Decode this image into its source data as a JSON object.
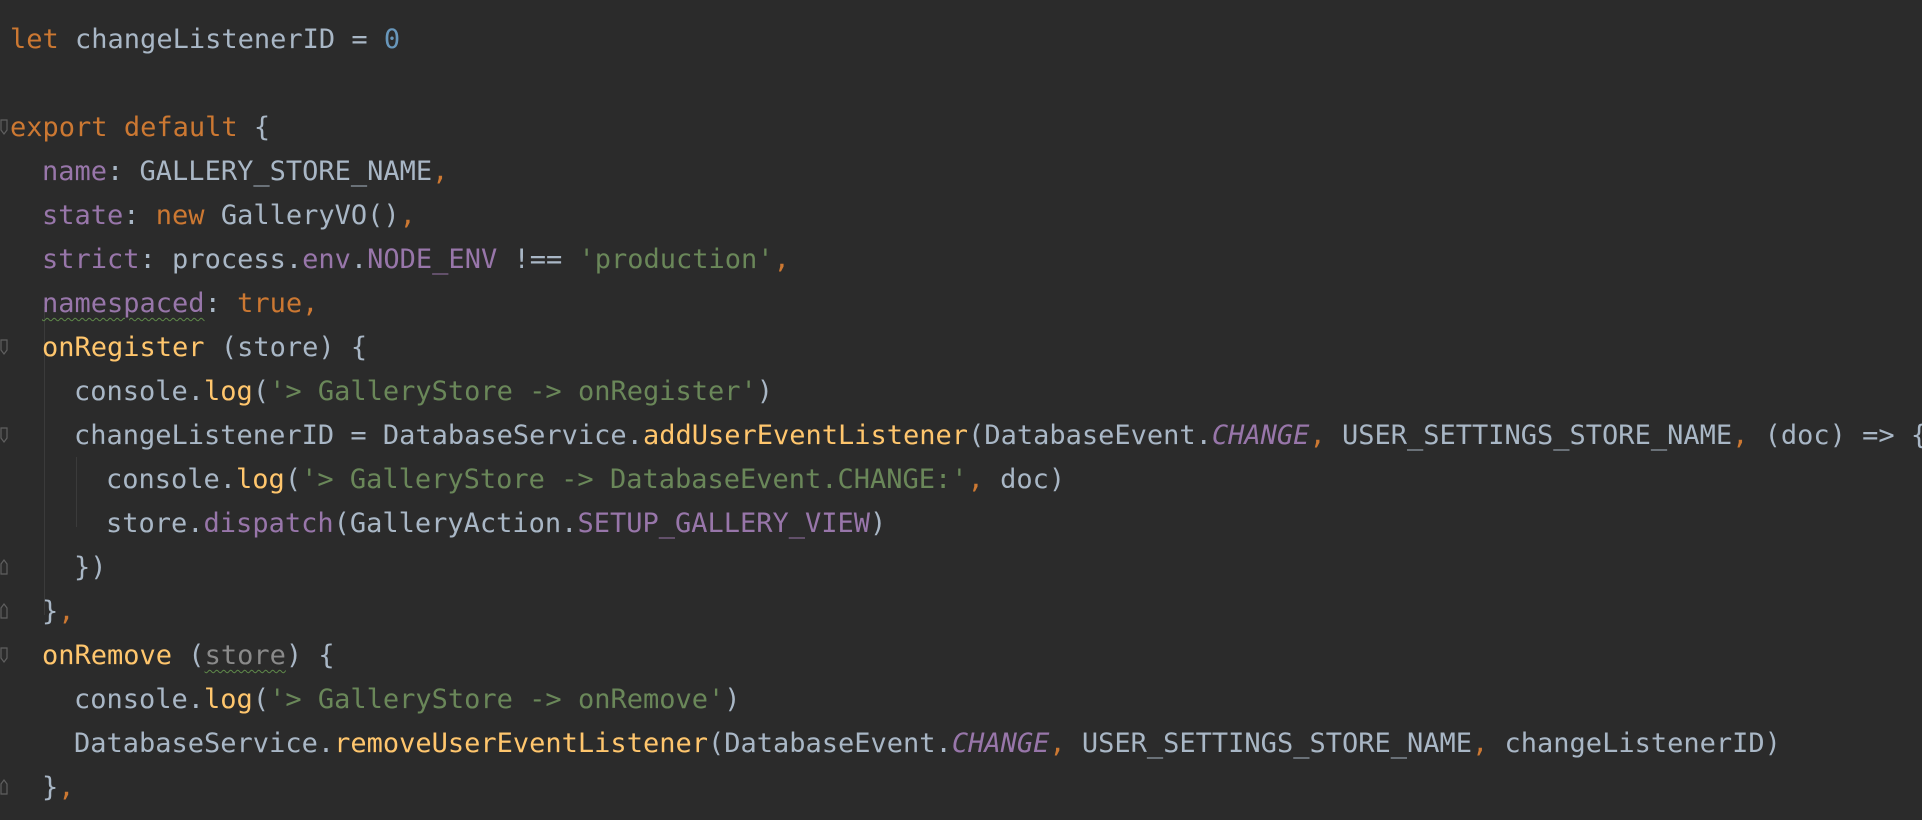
{
  "editor": {
    "language": "javascript",
    "colors": {
      "background": "#2b2b2b",
      "keyword": "#cc7832",
      "property": "#9876aa",
      "string": "#6a8759",
      "number": "#6897bb",
      "function": "#ffc66d",
      "text": "#a9b7c6"
    }
  },
  "code": {
    "l1": [
      "let",
      " changeListenerID = ",
      "0"
    ],
    "l3": [
      "export",
      " ",
      "default",
      " {"
    ],
    "l4": [
      "name",
      ": GALLERY_STORE_NAME",
      ","
    ],
    "l5": [
      "state",
      ": ",
      "new",
      " GalleryVO()",
      ","
    ],
    "l6": [
      "strict",
      ": process.",
      "env",
      ".",
      "NODE_ENV",
      " !== ",
      "'production'",
      ","
    ],
    "l7": [
      "namespaced",
      ": ",
      "true",
      ","
    ],
    "l8": [
      "onRegister",
      " (store) {"
    ],
    "l9": [
      "console.",
      "log",
      "(",
      "'> GalleryStore -> onRegister'",
      ")"
    ],
    "l10": [
      "changeListenerID = DatabaseService.",
      "addUserEventListener",
      "(DatabaseEvent.",
      "CHANGE",
      ", ",
      "USER_SETTINGS_STORE_NAME",
      ", ",
      "(doc) => {"
    ],
    "l11": [
      "console.",
      "log",
      "(",
      "'> GalleryStore -> DatabaseEvent.CHANGE:'",
      ", ",
      "doc)"
    ],
    "l12": [
      "store.",
      "dispatch",
      "(GalleryAction.",
      "SETUP_GALLERY_VIEW",
      ")"
    ],
    "l13": [
      "})"
    ],
    "l14": [
      "}",
      ","
    ],
    "l15": [
      "onRemove",
      " (",
      "store",
      ") {"
    ],
    "l16": [
      "console.",
      "log",
      "(",
      "'> GalleryStore -> onRemove'",
      ")"
    ],
    "l17": [
      "DatabaseService.",
      "removeUserEventListener",
      "(DatabaseEvent.",
      "CHANGE",
      ", ",
      "USER_SETTINGS_STORE_NAME",
      ", ",
      "changeListenerID)"
    ],
    "l18": [
      "}",
      ","
    ]
  }
}
